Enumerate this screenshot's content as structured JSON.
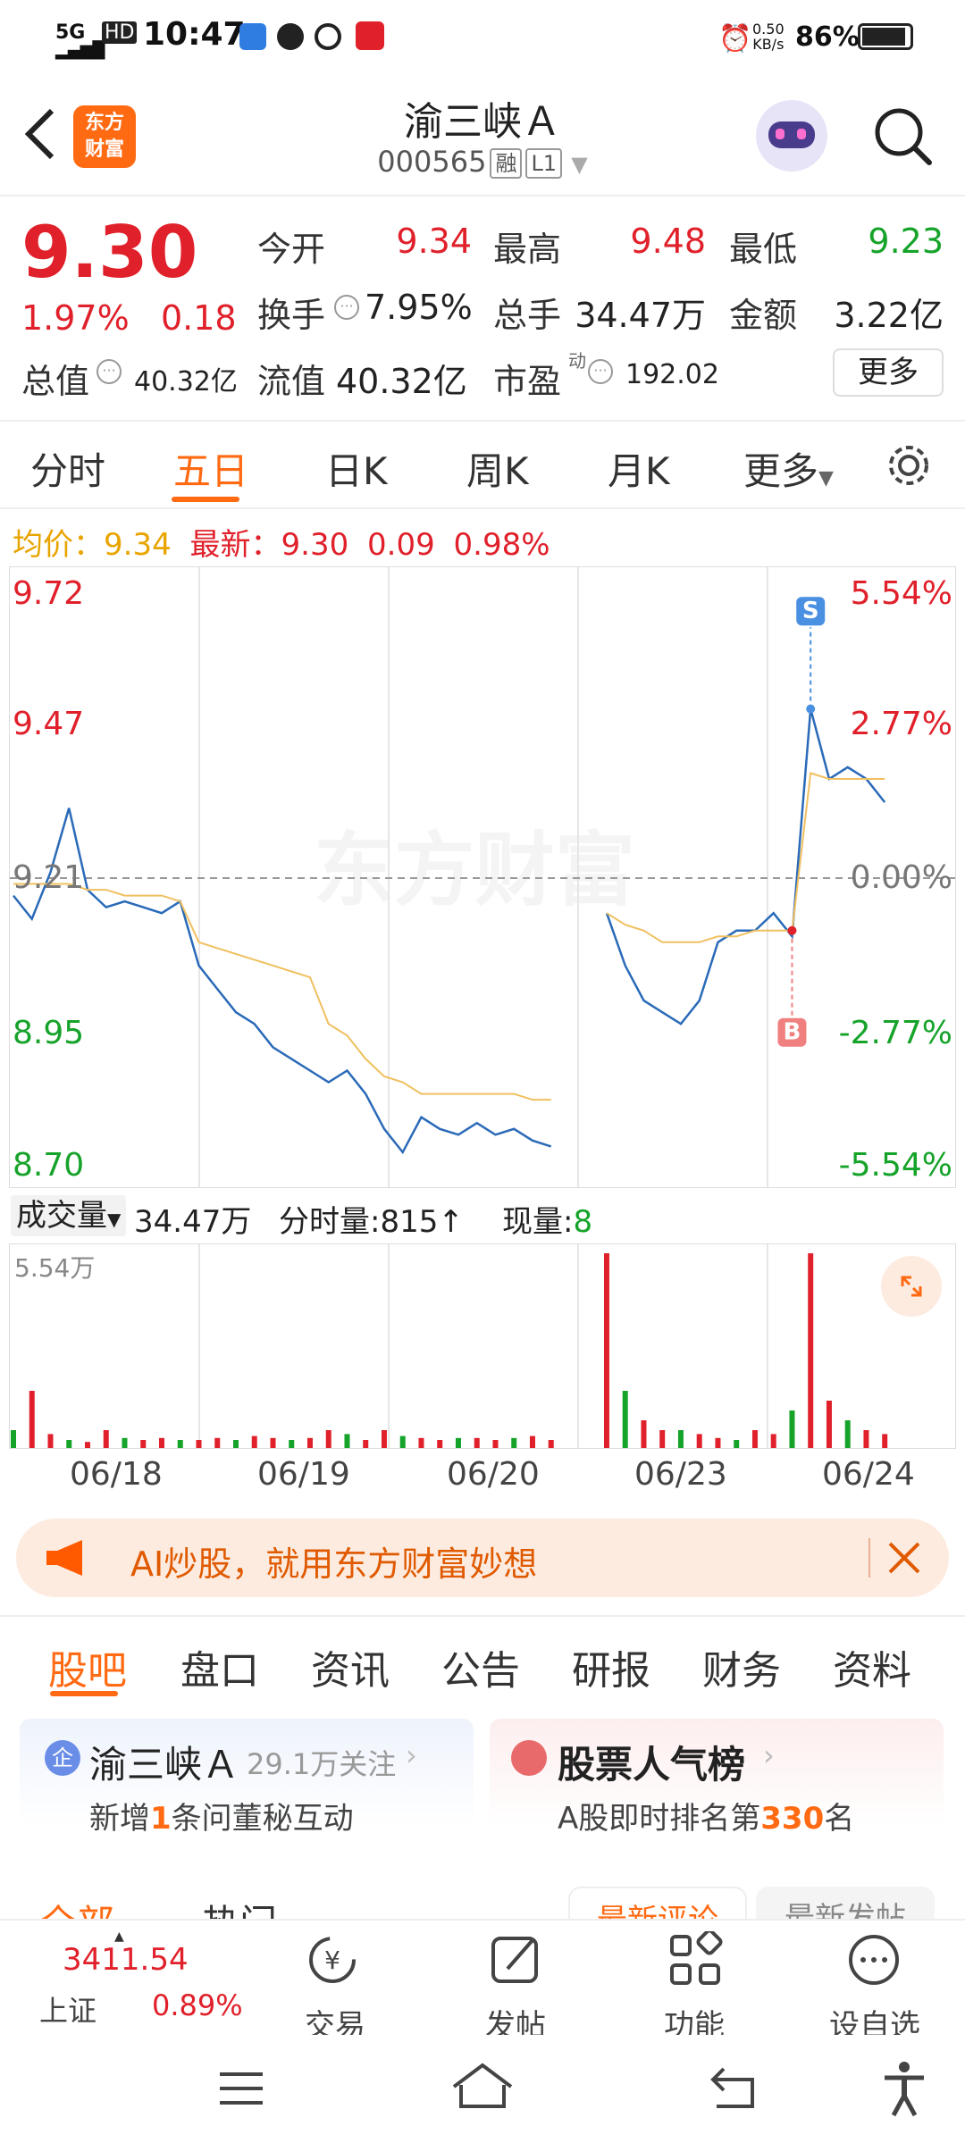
{
  "status_bar": {
    "network": "5G",
    "time": "10:47",
    "speed_value": "0.50",
    "speed_unit": "KB/s",
    "battery": "86%"
  },
  "header": {
    "back_icon": "chevron-left-icon",
    "logo_text_1": "东方",
    "logo_text_2": "财富",
    "stock_name": "渝三峡Ａ",
    "stock_code": "000565",
    "tag_rong": "融",
    "tag_level": "L1"
  },
  "quote": {
    "price": "9.30",
    "change_pct": "1.97%",
    "change_amt": "0.18",
    "open_label": "今开",
    "open": "9.34",
    "high_label": "最高",
    "high": "9.48",
    "low_label": "最低",
    "low": "9.23",
    "turnover_label": "换手",
    "turnover": "7.95%",
    "volume_label": "总手",
    "volume": "34.47万",
    "amount_label": "金额",
    "amount": "3.22亿",
    "mktcap_label": "总值",
    "mktcap": "40.32亿",
    "float_label": "流值",
    "float": "40.32亿",
    "pe_label": "市盈",
    "pe_sup": "动",
    "pe": "192.02",
    "more_label": "更多"
  },
  "tabs": [
    "分时",
    "五日",
    "日K",
    "周K",
    "月K",
    "更多"
  ],
  "active_tab": "五日",
  "legend": {
    "avg_label": "均价：",
    "avg": "9.34",
    "latest_label": "最新：",
    "latest": "9.30",
    "chg": "0.09",
    "chg_pct": "0.98%"
  },
  "chart_data": {
    "type": "line",
    "x": [
      "06/18",
      "06/19",
      "06/20",
      "06/23",
      "06/24"
    ],
    "y_ticks_left": [
      "9.72",
      "9.47",
      "9.21",
      "8.95",
      "8.70"
    ],
    "y_ticks_right": [
      "5.54%",
      "2.77%",
      "0.00%",
      "-2.77%",
      "-5.54%"
    ],
    "ylim": [
      8.7,
      9.72
    ],
    "prev_close": 9.21,
    "series": [
      {
        "values": [
          9.18,
          9.14,
          9.22,
          9.33,
          9.19,
          9.16,
          9.17,
          9.16,
          9.15,
          9.17,
          9.06,
          9.02,
          8.98,
          8.96,
          8.92,
          8.9,
          8.88,
          8.86,
          8.88,
          8.84,
          8.78,
          8.74,
          8.8,
          8.78,
          8.77,
          8.79,
          8.77,
          8.78,
          8.76,
          8.75,
          null,
          null,
          9.15,
          9.06,
          9.0,
          8.98,
          8.96,
          9.0,
          9.1,
          9.12,
          9.12,
          9.15,
          9.11,
          9.5,
          9.38,
          9.4,
          9.38,
          9.34
        ]
      },
      {
        "values": [
          9.2,
          9.2,
          9.2,
          9.2,
          9.19,
          9.19,
          9.18,
          9.18,
          9.18,
          9.17,
          9.1,
          9.09,
          9.08,
          9.07,
          9.06,
          9.05,
          9.04,
          8.96,
          8.94,
          8.9,
          8.87,
          8.86,
          8.84,
          8.84,
          8.84,
          8.84,
          8.84,
          8.84,
          8.83,
          8.83,
          null,
          null,
          9.15,
          9.13,
          9.12,
          9.1,
          9.1,
          9.1,
          9.11,
          9.11,
          9.12,
          9.12,
          9.12,
          9.39,
          9.38,
          9.38,
          9.38,
          9.38
        ]
      }
    ],
    "volume_max_label": "5.54万",
    "volume": [
      0.1,
      0.3,
      0.08,
      0.05,
      0.04,
      0.1,
      0.06,
      0.05,
      0.06,
      0.05,
      0.05,
      0.06,
      0.05,
      0.07,
      0.06,
      0.05,
      0.06,
      0.1,
      0.08,
      0.05,
      0.1,
      0.07,
      0.06,
      0.05,
      0.06,
      0.06,
      0.05,
      0.06,
      0.07,
      0.05,
      0,
      0,
      1.0,
      0.3,
      0.15,
      0.1,
      0.1,
      0.08,
      0.06,
      0.05,
      0.1,
      0.08,
      0.2,
      1.0,
      0.25,
      0.15,
      0.1,
      0.08
    ],
    "markers": [
      {
        "label": "S",
        "color": "#4a90e2"
      },
      {
        "label": "B",
        "color": "#f08080"
      }
    ]
  },
  "vol_bar": {
    "label": "成交量",
    "total": "34.47万",
    "fenshi_label": "分时量:",
    "fenshi": "815",
    "arrow": "↑",
    "now_label": "现量:",
    "now": "8"
  },
  "banner": {
    "text": "AI炒股，就用东方财富妙想"
  },
  "tabs2": [
    "股吧",
    "盘口",
    "资讯",
    "公告",
    "研报",
    "财务",
    "资料"
  ],
  "card1": {
    "title": "渝三峡Ａ",
    "follow": "29.1万关注",
    "desc_pre": "新增",
    "desc_num": "1",
    "desc_post": "条问董秘互动"
  },
  "card2": {
    "title": "股票人气榜",
    "desc_pre": "A股即时排名第",
    "desc_num": "330",
    "desc_post": "名"
  },
  "subtabs": {
    "all": "全部",
    "hot": "热门",
    "latest_comment": "最新评论",
    "latest_post": "最新发帖"
  },
  "bottom_nav": {
    "index_value": "3411.54",
    "index_name": "上证",
    "index_chg": "0.89%",
    "trade": "交易",
    "post": "发帖",
    "func": "功能",
    "watch": "设自选"
  }
}
